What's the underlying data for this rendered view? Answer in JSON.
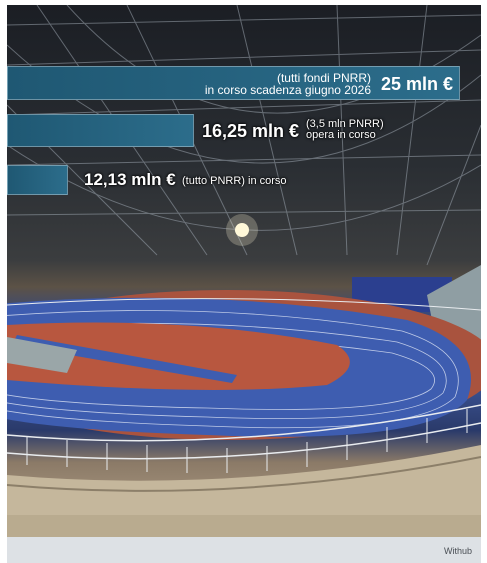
{
  "bars": [
    {
      "amount": "25 mln €",
      "note_line1": "(tutti fondi PNRR)",
      "note_line2": "in corso scadenza giugno 2026"
    },
    {
      "amount": "16,25 mln €",
      "note_line1": "(3,5 mln PNRR)",
      "note_line2": "opera in corso"
    },
    {
      "amount": "12,13 mln €",
      "note_line1": "(tutto PNRR) in corso"
    }
  ],
  "credit": "Withub",
  "colors": {
    "bar": "#2c6d8b",
    "track": "#3f5fb0",
    "track_red": "#b4553e",
    "caption_strip": "#dde1e5"
  }
}
